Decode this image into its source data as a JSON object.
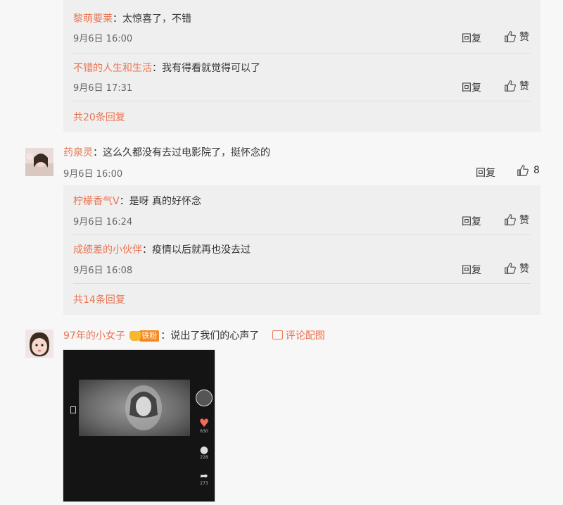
{
  "thread1": {
    "replies": [
      {
        "user": "黎萌要莱",
        "text": "：太惊喜了，不错",
        "time": "9月6日 16:00",
        "reply": "回复",
        "like": "赞"
      },
      {
        "user": "不错的人生和生活",
        "text": "：我有得看就觉得可以了",
        "time": "9月6日 17:31",
        "reply": "回复",
        "like": "赞"
      }
    ],
    "more": "共20条回复"
  },
  "comment2": {
    "user": "药泉灵",
    "text": "：这么久都没有去过电影院了，挺怀念的",
    "time": "9月6日 16:00",
    "reply": "回复",
    "likes": "8",
    "replies": [
      {
        "user": "柠檬香气V",
        "text": "：是呀 真的好怀念",
        "time": "9月6日 16:24",
        "reply": "回复",
        "like": "赞"
      },
      {
        "user": "成绩差的小伙伴",
        "text": "：疫情以后就再也没去过",
        "time": "9月6日 16:08",
        "reply": "回复",
        "like": "赞"
      }
    ],
    "more": "共14条回复"
  },
  "comment3": {
    "user": "97年的小女子",
    "badge": "铁粉",
    "text": "：说出了我们的心声了",
    "pic_link": "评论配图",
    "video_counts": {
      "likes": "630",
      "comments": "228",
      "shares": "273"
    }
  },
  "colors": {
    "accent": "#eb7350",
    "reply_bg": "#efefef"
  }
}
